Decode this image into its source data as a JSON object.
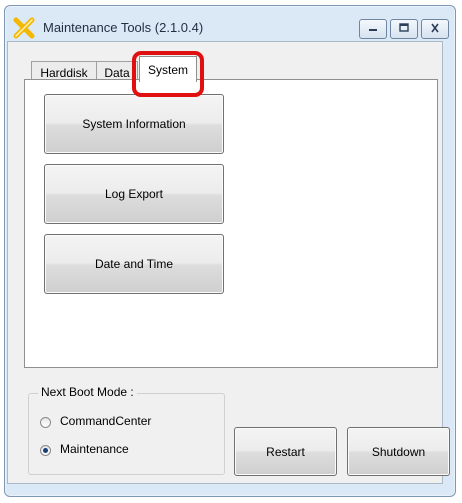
{
  "window": {
    "title": "Maintenance Tools (2.1.0.4)"
  },
  "tabs": [
    {
      "label": "Harddisk",
      "active": false
    },
    {
      "label": "Data",
      "active": false
    },
    {
      "label": "System",
      "active": true
    }
  ],
  "system_panel": {
    "buttons": [
      {
        "label": "System Information"
      },
      {
        "label": "Log Export"
      },
      {
        "label": "Date and Time"
      }
    ]
  },
  "boot_mode": {
    "label": "Next Boot Mode :",
    "options": [
      {
        "label": "CommandCenter",
        "selected": false
      },
      {
        "label": "Maintenance",
        "selected": true
      }
    ]
  },
  "actions": {
    "restart_label": "Restart",
    "shutdown_label": "Shutdown"
  },
  "icons": {
    "app": "tools-icon",
    "minimize": "minimize-icon",
    "maximize": "maximize-icon",
    "close": "close-icon"
  },
  "colors": {
    "highlight": "#e01010",
    "app_icon": "#f5b800"
  }
}
